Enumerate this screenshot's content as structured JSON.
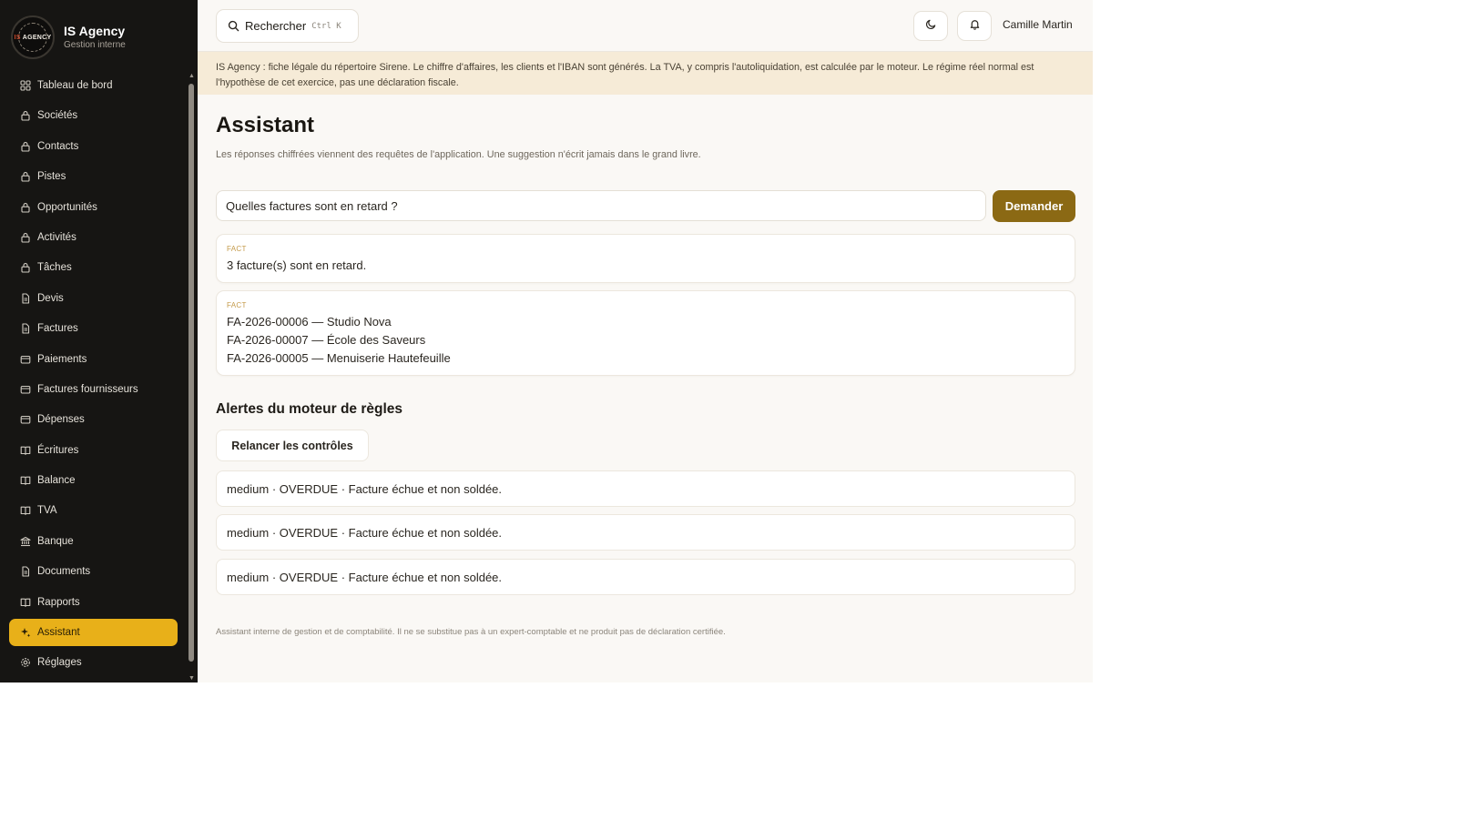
{
  "brand": {
    "logo_text_is": "IS",
    "logo_text_agency": "AGENCY",
    "name": "IS Agency",
    "subtitle": "Gestion interne"
  },
  "sidebar": {
    "items": [
      {
        "label": "Tableau de bord",
        "icon": "grid-icon"
      },
      {
        "label": "Sociétés",
        "icon": "lock-icon"
      },
      {
        "label": "Contacts",
        "icon": "lock-icon"
      },
      {
        "label": "Pistes",
        "icon": "lock-icon"
      },
      {
        "label": "Opportunités",
        "icon": "lock-icon"
      },
      {
        "label": "Activités",
        "icon": "lock-icon"
      },
      {
        "label": "Tâches",
        "icon": "lock-icon"
      },
      {
        "label": "Devis",
        "icon": "file-icon"
      },
      {
        "label": "Factures",
        "icon": "file-icon"
      },
      {
        "label": "Paiements",
        "icon": "wallet-icon"
      },
      {
        "label": "Factures fournisseurs",
        "icon": "wallet-icon"
      },
      {
        "label": "Dépenses",
        "icon": "wallet-icon"
      },
      {
        "label": "Écritures",
        "icon": "book-icon"
      },
      {
        "label": "Balance",
        "icon": "book-icon"
      },
      {
        "label": "TVA",
        "icon": "book-icon"
      },
      {
        "label": "Banque",
        "icon": "bank-icon"
      },
      {
        "label": "Documents",
        "icon": "file-icon"
      },
      {
        "label": "Rapports",
        "icon": "book-icon"
      },
      {
        "label": "Assistant",
        "icon": "sparkle-icon",
        "active": true
      },
      {
        "label": "Réglages",
        "icon": "gear-icon"
      }
    ]
  },
  "topbar": {
    "search_label": "Rechercher",
    "search_shortcut": "Ctrl K",
    "user_name": "Camille Martin"
  },
  "banner": {
    "text": "IS Agency : fiche légale du répertoire Sirene. Le chiffre d'affaires, les clients et l'IBAN sont générés. La TVA, y compris l'autoliquidation, est calculée par le moteur. Le régime réel normal est l'hypothèse de cet exercice, pas une déclaration fiscale."
  },
  "main": {
    "title": "Assistant",
    "subtitle": "Les réponses chiffrées viennent des requêtes de l'application. Une suggestion n'écrit jamais dans le grand livre.",
    "question_value": "Quelles factures sont en retard ?",
    "ask_button": "Demander",
    "answers": [
      {
        "tag": "FACT",
        "lines": [
          "3 facture(s) sont en retard."
        ]
      },
      {
        "tag": "FACT",
        "lines": [
          "FA-2026-00006 — Studio Nova",
          "FA-2026-00007 — École des Saveurs",
          "FA-2026-00005 — Menuiserie Hautefeuille"
        ]
      }
    ],
    "rules_title": "Alertes du moteur de règles",
    "rerun_button": "Relancer les contrôles",
    "alerts": [
      "medium · OVERDUE · Facture échue et non soldée.",
      "medium · OVERDUE · Facture échue et non soldée.",
      "medium · OVERDUE · Facture échue et non soldée."
    ],
    "footer": "Assistant interne de gestion et de comptabilité. Il ne se substitue pas à un expert-comptable et ne produit pas de déclaration certifiée."
  },
  "colors": {
    "sidebar_bg": "#161513",
    "active_nav": "#e8b019",
    "primary_button": "#8b6914",
    "banner_bg": "#f6ebd7",
    "page_bg": "#faf8f5"
  }
}
